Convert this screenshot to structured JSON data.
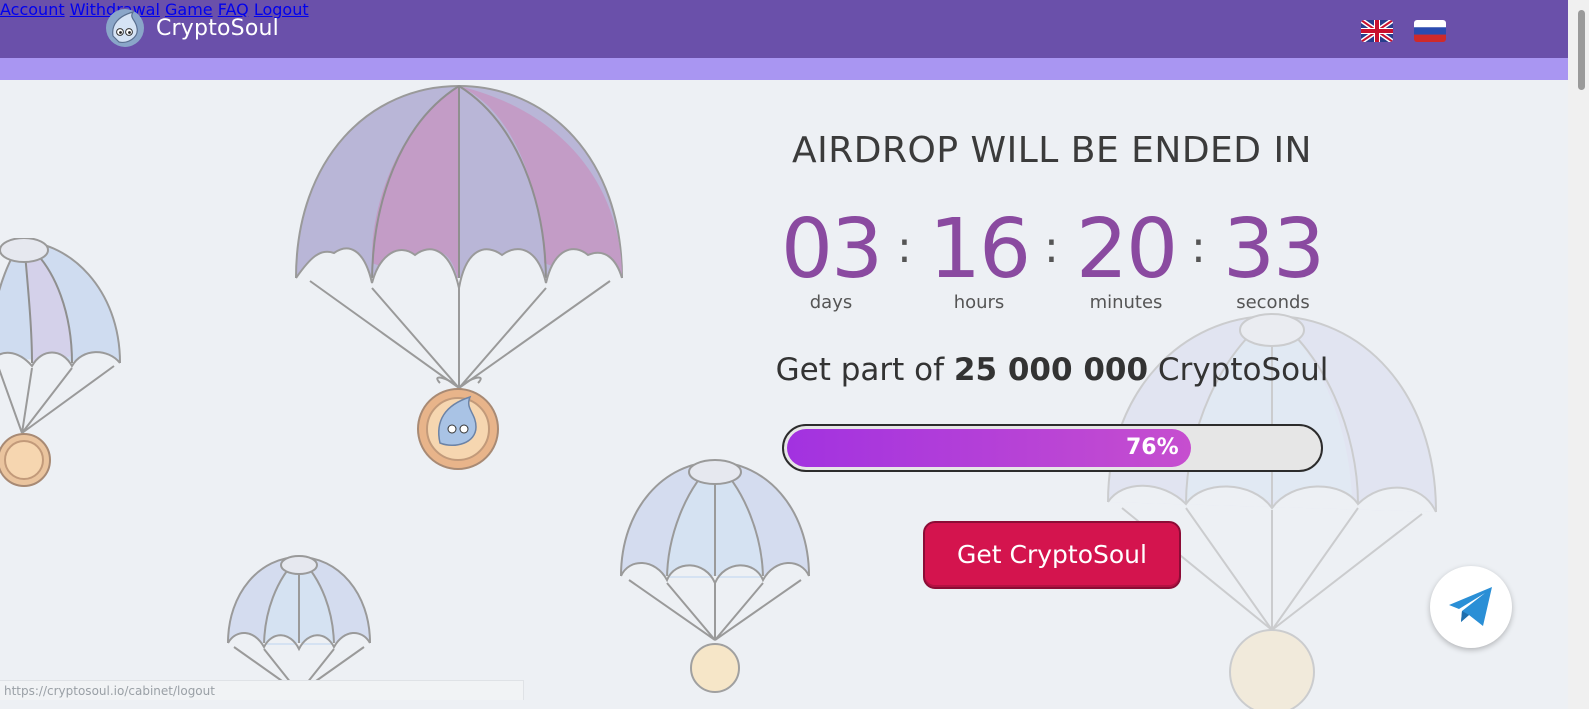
{
  "header": {
    "brand": "CryptoSoul",
    "nav": [
      "Account",
      "Withdrawal",
      "Game",
      "FAQ",
      "Logout"
    ],
    "languages": [
      "english-flag",
      "russian-flag"
    ]
  },
  "main": {
    "headline": "AIRDROP WILL BE ENDED IN",
    "timer": [
      {
        "value": "03",
        "label": "days"
      },
      {
        "value": "16",
        "label": "hours"
      },
      {
        "value": "20",
        "label": "minutes"
      },
      {
        "value": "33",
        "label": "seconds"
      }
    ],
    "subtitle_prefix": "Get part of",
    "subtitle_amount": "25 000 000",
    "subtitle_suffix": "CryptoSoul",
    "progress_percent": 76,
    "progress_label": "76%",
    "cta_label": "Get CryptoSoul"
  },
  "status_url": "https://cryptosoul.io/cabinet/logout",
  "colors": {
    "header_bg": "#6a50aa",
    "header_accent": "#a996f2",
    "timer_digits": "#8a4aa0",
    "cta_bg": "#d4144e",
    "progress_fill": "#a232e0"
  }
}
